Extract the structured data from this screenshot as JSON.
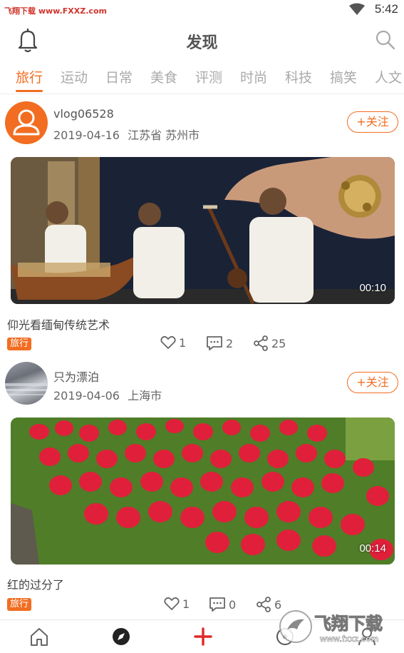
{
  "status_bar": {
    "watermark": "飞翔下载 www.FXXZ.com",
    "time": "5:42"
  },
  "header": {
    "title": "发现"
  },
  "tabs": [
    {
      "label": "旅行",
      "active": true
    },
    {
      "label": "运动",
      "active": false
    },
    {
      "label": "日常",
      "active": false
    },
    {
      "label": "美食",
      "active": false
    },
    {
      "label": "评测",
      "active": false
    },
    {
      "label": "时尚",
      "active": false
    },
    {
      "label": "科技",
      "active": false
    },
    {
      "label": "搞笑",
      "active": false
    },
    {
      "label": "人文",
      "active": false
    }
  ],
  "posts": [
    {
      "username": "vlog06528",
      "date": "2019-04-16",
      "location": "江苏省 苏州市",
      "follow_label": "+关注",
      "duration": "00:10",
      "caption": "仰光看缅甸传统艺术",
      "tag": "旅行",
      "likes": "1",
      "comments": "2",
      "shares": "25"
    },
    {
      "username": "只为漂泊",
      "date": "2019-04-06",
      "location": "上海市",
      "follow_label": "+关注",
      "duration": "00:14",
      "caption": "红的过分了",
      "tag": "旅行",
      "likes": "1",
      "comments": "0",
      "shares": "6"
    }
  ],
  "bottom_watermark": {
    "brand": "飞翔下载",
    "url": "www.fxxz.com"
  },
  "colors": {
    "accent": "#f26d21",
    "tab_inactive": "#a9a9a9"
  },
  "icons": [
    "bell-icon",
    "search-icon",
    "heart-icon",
    "comment-icon",
    "share-icon",
    "home-icon",
    "compass-icon",
    "plus-icon",
    "music-icon",
    "profile-icon"
  ]
}
